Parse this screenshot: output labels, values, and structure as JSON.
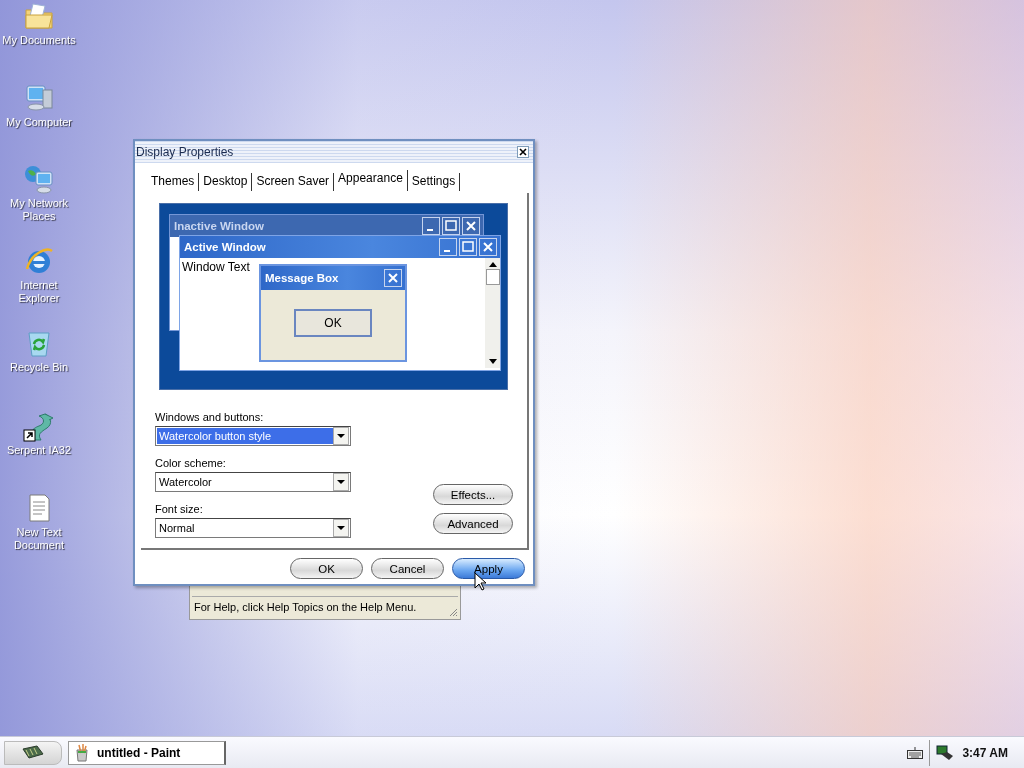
{
  "desktop_icons": [
    {
      "label": "My Documents",
      "kind": "folder",
      "shortcut": false
    },
    {
      "label": "My Computer",
      "kind": "computer",
      "shortcut": false
    },
    {
      "label": "My Network Places",
      "kind": "network",
      "shortcut": false
    },
    {
      "label": "Internet Explorer",
      "kind": "browser",
      "shortcut": false
    },
    {
      "label": "Recycle Bin",
      "kind": "recycle",
      "shortcut": false
    },
    {
      "label": "Serpent IA32",
      "kind": "dragon",
      "shortcut": true
    },
    {
      "label": "New Text Document",
      "kind": "textdoc",
      "shortcut": false
    }
  ],
  "paint_window": {
    "status_text": "For Help, click Help Topics on the Help Menu."
  },
  "dialog": {
    "title": "Display Properties",
    "tabs": [
      {
        "label": "Themes",
        "selected": false
      },
      {
        "label": "Desktop",
        "selected": false
      },
      {
        "label": "Screen Saver",
        "selected": false
      },
      {
        "label": "Appearance",
        "selected": true
      },
      {
        "label": "Settings",
        "selected": false
      }
    ],
    "preview": {
      "inactive_title": "Inactive Window",
      "active_title": "Active Window",
      "window_text": "Window Text",
      "message_title": "Message Box",
      "message_button": "OK"
    },
    "fields": [
      {
        "label": "Windows and buttons:",
        "value": "Watercolor button style",
        "focused": true
      },
      {
        "label": "Color scheme:",
        "value": "Watercolor",
        "focused": false
      },
      {
        "label": "Font size:",
        "value": "Normal",
        "focused": false
      }
    ],
    "side_buttons": [
      "Effects...",
      "Advanced"
    ],
    "buttons": [
      {
        "label": "OK",
        "hover": false
      },
      {
        "label": "Cancel",
        "hover": false
      },
      {
        "label": "Apply",
        "hover": true
      }
    ]
  },
  "taskbar": {
    "task": "untitled - Paint",
    "clock": "3:47 AM"
  }
}
